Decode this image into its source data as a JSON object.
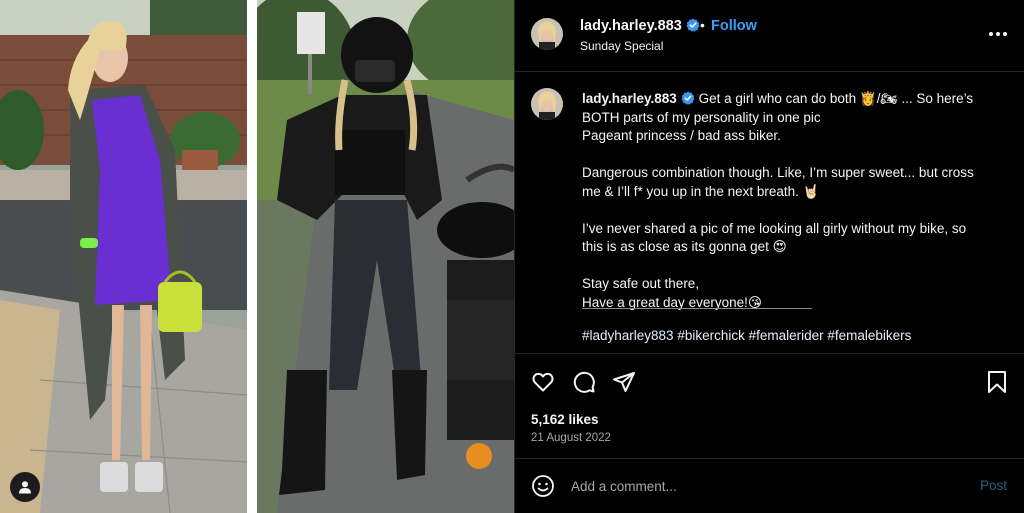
{
  "header": {
    "username": "lady.harley.883",
    "follow_label": "Follow",
    "subtitle": "Sunday Special"
  },
  "caption": {
    "username": "lady.harley.883",
    "line1": "Get a girl who can do both 👸/🏍 ... So here’s",
    "line2": "BOTH parts of my personality in one pic",
    "line3": "Pageant princess / bad ass biker.",
    "line4": "Dangerous combination though. Like, I’m super sweet... but cross",
    "line5": "me & I’ll f* you up in the next breath. 🤘🏻",
    "line6": "I’ve never shared a pic of me looking all girly without my bike, so",
    "line7": "this is as close as its gonna get 😍",
    "line8": "Stay safe out there,",
    "line9": "Have a great day everyone!😘",
    "hashtags": "#ladyharley883 #bikerchick #femalerider #femalebikers"
  },
  "stats": {
    "likes": "5,162 likes",
    "date": "21 August 2022"
  },
  "comment": {
    "placeholder": "Add a comment...",
    "post_label": "Post"
  },
  "colors": {
    "background": "#000000",
    "follow_blue": "#3aa0ff",
    "verified_blue": "#3897f0",
    "post_disabled": "#2a5e88"
  },
  "icons": {
    "verified": "verified-badge-icon",
    "more": "more-horizontal-icon",
    "like": "heart-icon",
    "comment": "comment-icon",
    "share": "send-icon",
    "save": "bookmark-icon",
    "emoji": "emoji-icon",
    "user": "user-icon"
  }
}
